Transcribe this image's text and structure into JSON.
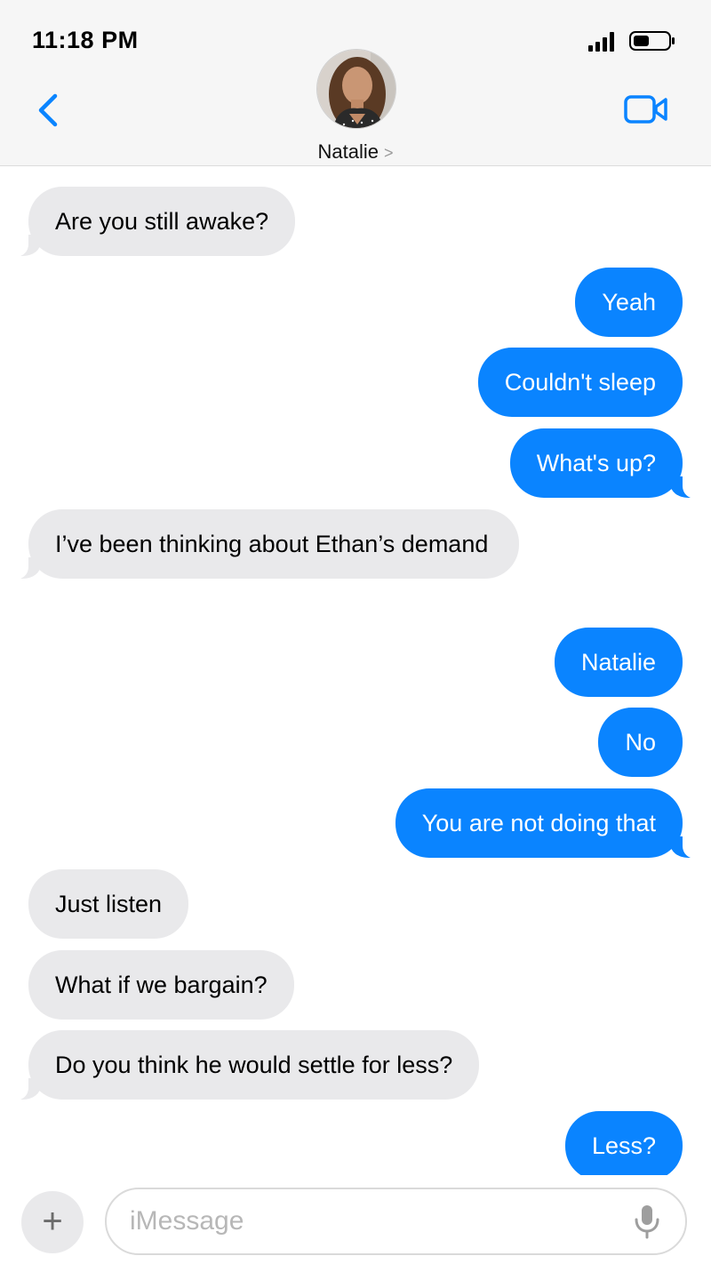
{
  "status_bar": {
    "time": "11:18 PM"
  },
  "header": {
    "contact_name": "Natalie",
    "contact_chevron": ">"
  },
  "messages": [
    {
      "from": "them",
      "text": "Are you still awake?"
    },
    {
      "from": "me",
      "text": "Yeah"
    },
    {
      "from": "me",
      "text": "Couldn't sleep"
    },
    {
      "from": "me",
      "text": "What's up?"
    },
    {
      "from": "them",
      "text": "I’ve been thinking about Ethan’s demand"
    },
    {
      "from": "me",
      "text": "Natalie"
    },
    {
      "from": "me",
      "text": "No"
    },
    {
      "from": "me",
      "text": "You are not doing that"
    },
    {
      "from": "them",
      "text": "Just listen"
    },
    {
      "from": "them",
      "text": "What if we bargain?"
    },
    {
      "from": "them",
      "text": "Do you think he would settle for less?"
    },
    {
      "from": "me",
      "text": "Less?"
    }
  ],
  "input": {
    "placeholder": "iMessage",
    "value": "",
    "plus_label": "+"
  },
  "icons": {
    "back": "chevron-left-icon",
    "video": "video-camera-icon",
    "signal": "signal-bars-icon",
    "battery": "battery-icon",
    "mic": "microphone-icon"
  },
  "colors": {
    "accent": "#0a84ff",
    "received_bubble": "#e9e9eb",
    "header_bg": "#f6f6f6"
  }
}
